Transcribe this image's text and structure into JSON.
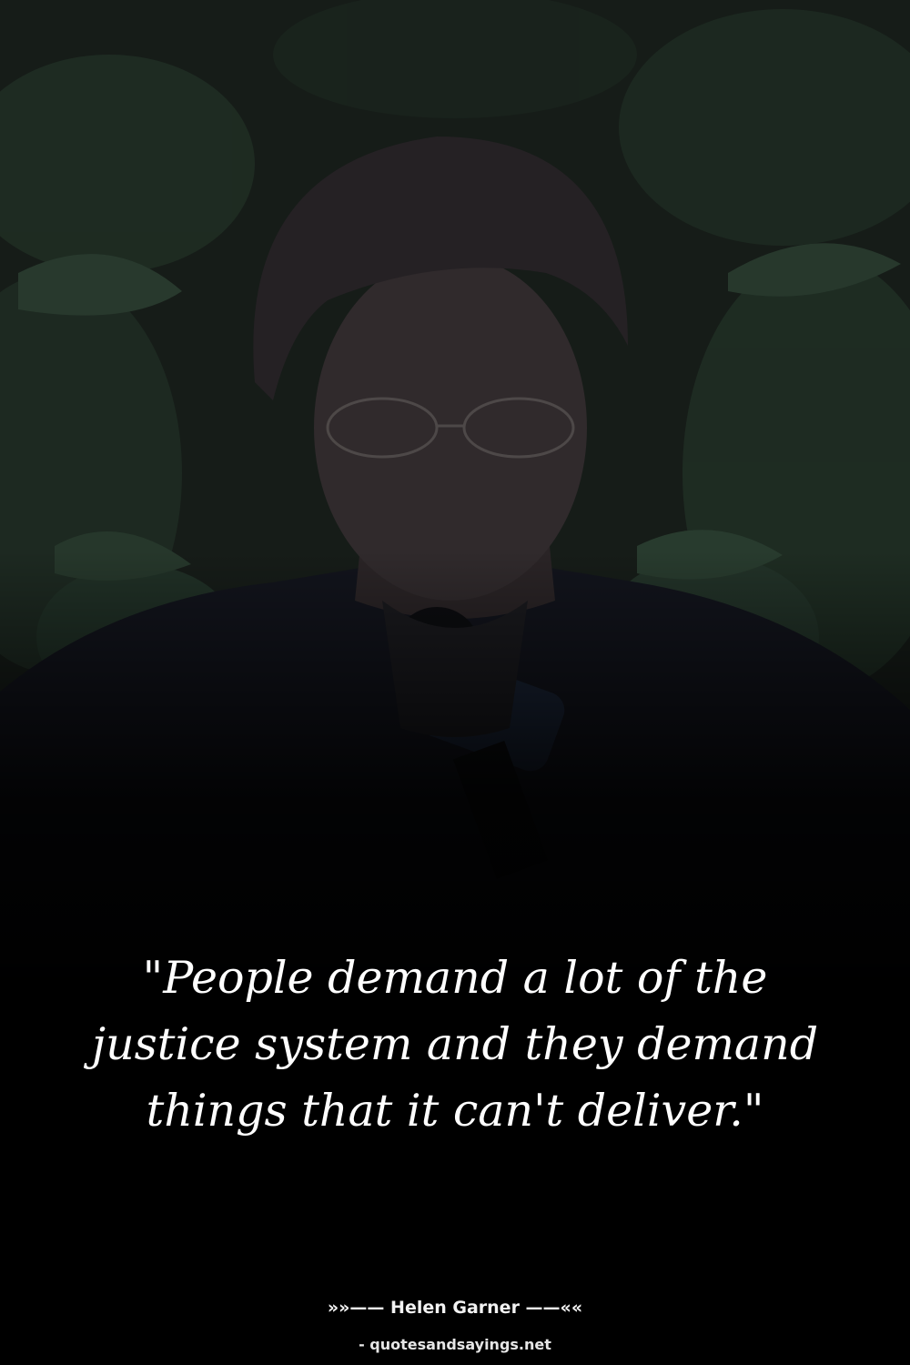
{
  "quote": {
    "text": "\"People demand a lot of the justice system and they demand things that it can't deliver.\""
  },
  "author": {
    "attribution": "»»—— Helen Garner ——««"
  },
  "source": {
    "site": "- quotesandsayings.net"
  },
  "colors": {
    "background": "#000000",
    "text": "#ffffff",
    "foliage": "#1b2a20"
  }
}
